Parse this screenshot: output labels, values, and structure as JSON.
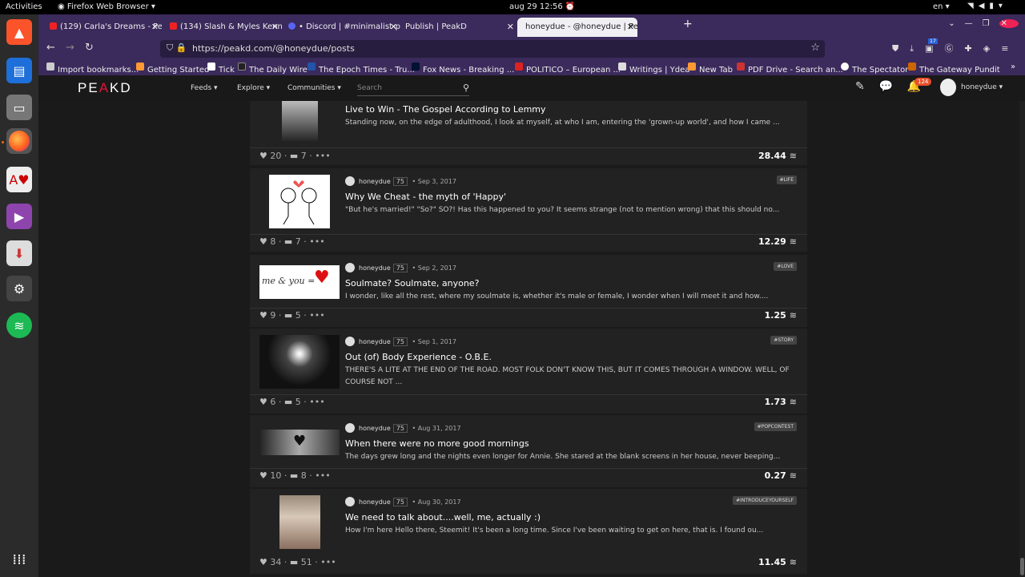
{
  "os": {
    "activities": "Activities",
    "app_name": "Firefox Web Browser",
    "datetime": "aug 29  12:56",
    "lang": "en"
  },
  "tabs": [
    {
      "label": "(129) Carla's Dreams - Pe",
      "active": false
    },
    {
      "label": "(134) Slash & Myles Kenn",
      "active": false
    },
    {
      "label": "• Discord | #minimalist-p",
      "active": false
    },
    {
      "label": "Publish | PeakD",
      "active": false
    },
    {
      "label": "honeydue - @honeydue | Pe",
      "active": true
    }
  ],
  "url": "https://peakd.com/@honeydue/posts",
  "bookmarks": [
    "Import bookmarks...",
    "Getting Started",
    "Tick",
    "The Daily Wire",
    "The Epoch Times - Tru...",
    "Fox News - Breaking ...",
    "POLITICO – European ...",
    "Writings | Ydea",
    "New Tab",
    "PDF Drive - Search an...",
    "The Spectator",
    "The Gateway Pundit"
  ],
  "nav_badge": "17",
  "site": {
    "logo_main": "PE",
    "logo_accent": "A",
    "logo_tail": "KD",
    "menu": [
      "Feeds",
      "Explore",
      "Communities"
    ],
    "search_placeholder": "Search",
    "notif_count": "124",
    "username": "honeydue"
  },
  "posts": [
    {
      "author": "",
      "rep": "",
      "date": "",
      "tag": "",
      "title": "Live to Win - The Gospel According to Lemmy",
      "excerpt": "Standing now, on the edge of adulthood, I look at myself, at who I am, entering the 'grown-up world', and how I came ...",
      "votes": "20",
      "comments": "7",
      "payout": "28.44"
    },
    {
      "author": "honeydue",
      "rep": "75",
      "date": "Sep 3, 2017",
      "tag": "#LIFE",
      "title": "Why We Cheat - the myth of 'Happy'",
      "excerpt": "\"But he's married!\" \"So?\" SO?! Has this happened to you? It seems strange (not to mention wrong) that this should no...",
      "votes": "8",
      "comments": "7",
      "payout": "12.29"
    },
    {
      "author": "honeydue",
      "rep": "75",
      "date": "Sep 2, 2017",
      "tag": "#LOVE",
      "title": "Soulmate? Soulmate, anyone?",
      "excerpt": "I wonder, like all the rest, where my soulmate is, whether it's male or female, I wonder when I will meet it and how....",
      "votes": "9",
      "comments": "5",
      "payout": "1.25"
    },
    {
      "author": "honeydue",
      "rep": "75",
      "date": "Sep 1, 2017",
      "tag": "#STORY",
      "title": "Out (of) Body Experience - O.B.E.",
      "excerpt": "THERE'S A LITE AT THE END OF THE ROAD. MOST FOLK DON'T KNOW THIS, BUT IT COMES THROUGH A WINDOW. WELL, OF COURSE NOT ...",
      "votes": "6",
      "comments": "5",
      "payout": "1.73"
    },
    {
      "author": "honeydue",
      "rep": "75",
      "date": "Aug 31, 2017",
      "tag": "#POPCONTEST",
      "title": "When there were no more good mornings",
      "excerpt": "The days grew long and the nights even longer for Annie. She stared at the blank screens in her house, never beeping...",
      "votes": "10",
      "comments": "8",
      "payout": "0.27"
    },
    {
      "author": "honeydue",
      "rep": "75",
      "date": "Aug 30, 2017",
      "tag": "#INTRODUCEYOURSELF",
      "title": "We need to talk about....well, me, actually :)",
      "excerpt": "How I'm here Hello there, Steemit! It's been a long time. Since I've been waiting to get on here, that is. I found ou...",
      "votes": "34",
      "comments": "51",
      "payout": "11.45"
    }
  ],
  "thumb_text": {
    "soulmate": "me & you ="
  },
  "colors": {
    "brand_red": "#e31337",
    "tab_bar": "#3b2a5c",
    "badge": "#e8502c"
  }
}
